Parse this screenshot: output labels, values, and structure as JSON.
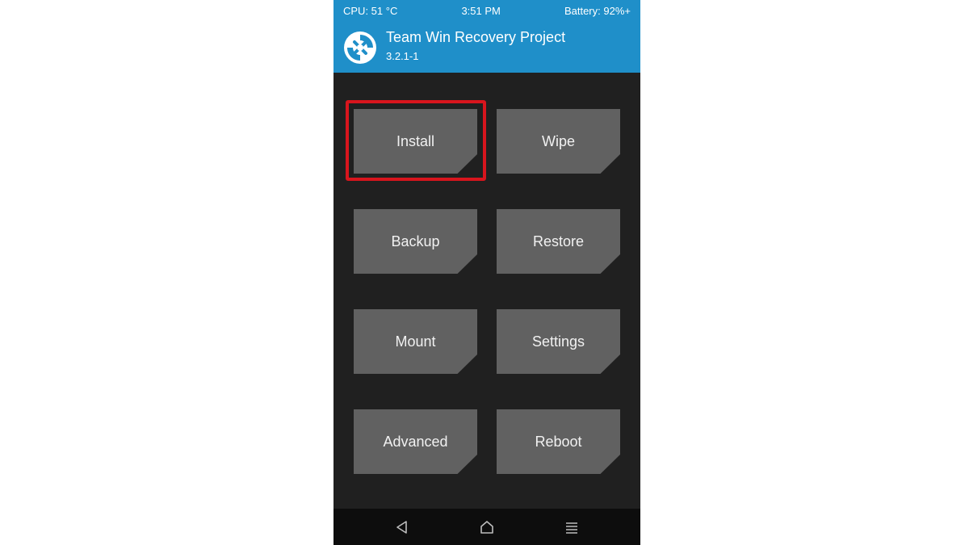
{
  "status_bar": {
    "cpu": "CPU: 51 °C",
    "time": "3:51 PM",
    "battery": "Battery: 92%+"
  },
  "header": {
    "title": "Team Win Recovery Project",
    "version": "3.2.1-1",
    "logo_icon": "twrp-logo-icon"
  },
  "menu": {
    "install": "Install",
    "wipe": "Wipe",
    "backup": "Backup",
    "restore": "Restore",
    "mount": "Mount",
    "settings": "Settings",
    "advanced": "Advanced",
    "reboot": "Reboot"
  },
  "nav_bar": {
    "back_icon": "back-triangle-icon",
    "home_icon": "home-icon",
    "menu_icon": "menu-lines-icon"
  },
  "colors": {
    "header_blue": "#1f8fc9",
    "background": "#202020",
    "button_gray": "#616161",
    "highlight_red": "#d8151d",
    "nav_black": "#0d0d0d"
  }
}
